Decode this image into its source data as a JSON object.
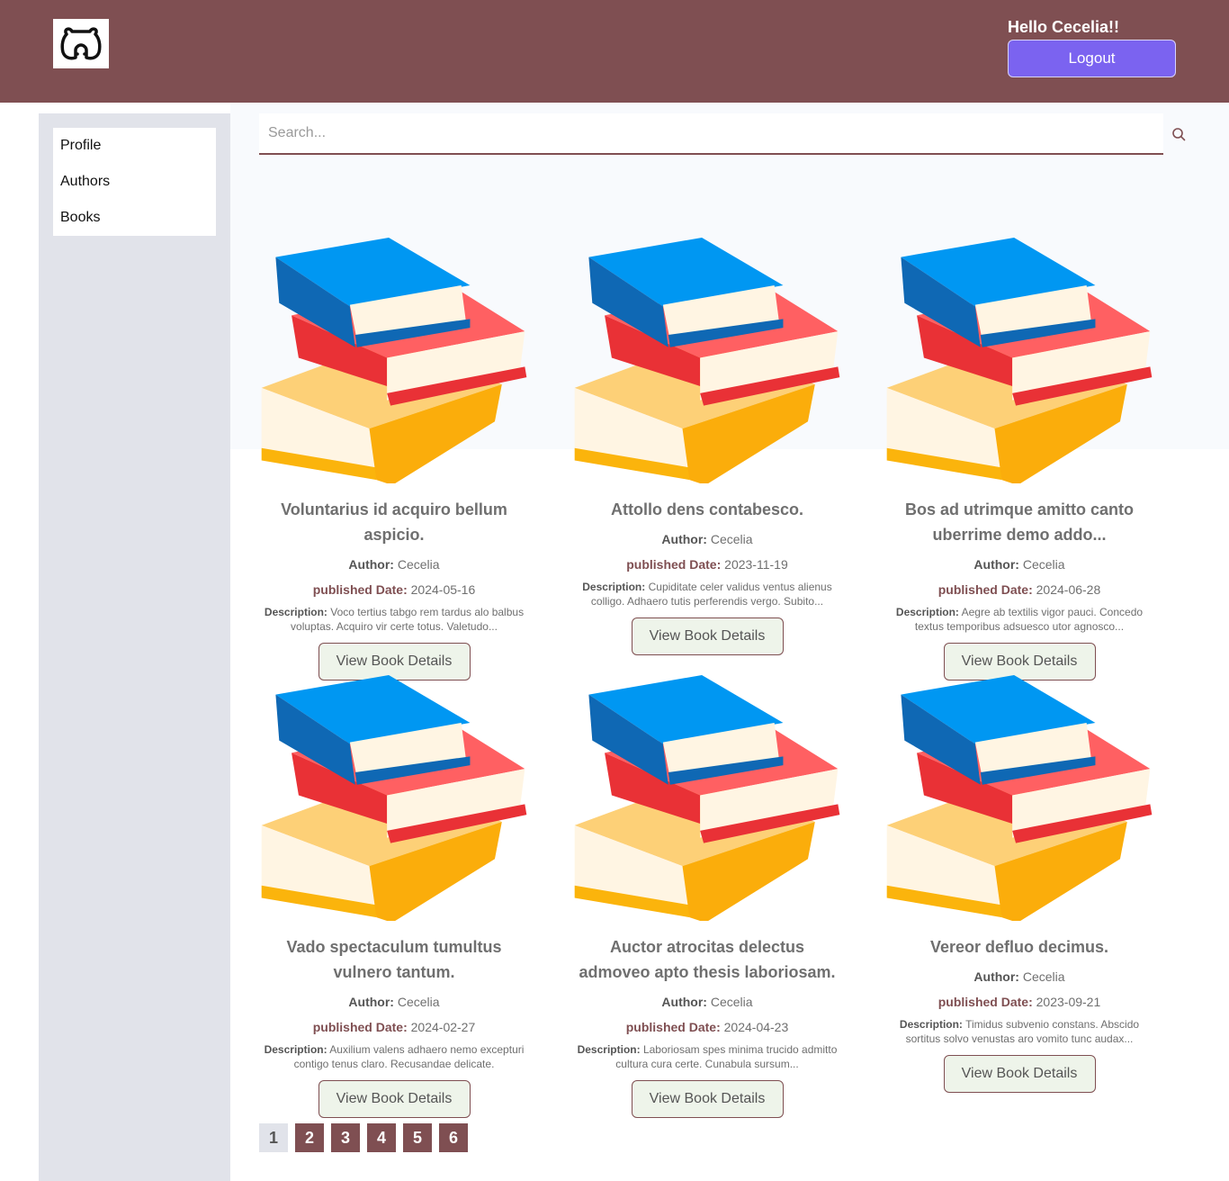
{
  "header": {
    "greeting": "Hello Cecelia!!",
    "logout_label": "Logout",
    "logo_icon": "bear-face-icon"
  },
  "sidebar": {
    "items": [
      {
        "label": "Profile"
      },
      {
        "label": "Authors"
      },
      {
        "label": "Books"
      }
    ]
  },
  "search": {
    "placeholder": "Search...",
    "icon": "search-icon"
  },
  "labels": {
    "author": "Author:",
    "published": "published Date:",
    "description": "Description:",
    "view_button": "View Book Details"
  },
  "books": [
    {
      "title": "Voluntarius id acquiro bellum aspicio.",
      "author": "Cecelia",
      "published": "2024-05-16",
      "description": "Voco tertius tabgo rem tardus alo balbus voluptas. Acquiro vir certe totus. Valetudo..."
    },
    {
      "title": "Attollo dens contabesco.",
      "author": "Cecelia",
      "published": "2023-11-19",
      "description": "Cupiditate celer validus ventus alienus colligo. Adhaero tutis perferendis vergo. Subito..."
    },
    {
      "title": "Bos ad utrimque amitto canto uberrime demo addo...",
      "author": "Cecelia",
      "published": "2024-06-28",
      "description": "Aegre ab textilis vigor pauci. Concedo textus temporibus adsuesco utor agnosco..."
    },
    {
      "title": "Vado spectaculum tumultus vulnero tantum.",
      "author": "Cecelia",
      "published": "2024-02-27",
      "description": "Auxilium valens adhaero nemo excepturi contigo tenus claro. Recusandae delicate."
    },
    {
      "title": "Auctor atrocitas delectus admoveo apto thesis laboriosam.",
      "author": "Cecelia",
      "published": "2024-04-23",
      "description": "Laboriosam spes minima trucido admitto cultura cura certe. Cunabula sursum..."
    },
    {
      "title": "Vereor defluo decimus.",
      "author": "Cecelia",
      "published": "2023-09-21",
      "description": "Timidus subvenio constans. Abscido sortitus solvo venustas aro vomito tunc audax..."
    }
  ],
  "pagination": {
    "pages": [
      "1",
      "2",
      "3",
      "4",
      "5",
      "6"
    ],
    "current": "1"
  },
  "colors": {
    "header_bg": "#7f4f52",
    "logout_bg": "#7b63f0",
    "sidebar_bg": "#e1e3ea",
    "accent": "#7f4f52",
    "button_bg": "#eef4ea"
  }
}
